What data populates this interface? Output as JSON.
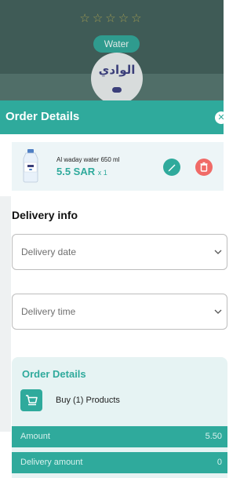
{
  "background": {
    "stars": "☆☆☆☆☆",
    "category_pill": "Water",
    "brand_logo_text": "الوادي"
  },
  "header": {
    "title": "Order Details",
    "close_glyph": "✕"
  },
  "product": {
    "name": "Al waday water 650 ml",
    "price": "5.5 SAR",
    "quantity": "x 1",
    "edit_icon": "pencil-icon",
    "delete_icon": "trash-icon"
  },
  "delivery": {
    "title": "Delivery info",
    "date_placeholder": "Delivery date",
    "time_placeholder": "Delivery time"
  },
  "summary": {
    "title": "Order Details",
    "buy_text": "Buy (1) Products",
    "amount_label": "Amount",
    "amount_value": "5.50",
    "delivery_label": "Delivery amount",
    "delivery_value": "0"
  },
  "colors": {
    "accent": "#2faa9c",
    "danger": "#f06a67",
    "card_bg": "#e6f3f3"
  }
}
